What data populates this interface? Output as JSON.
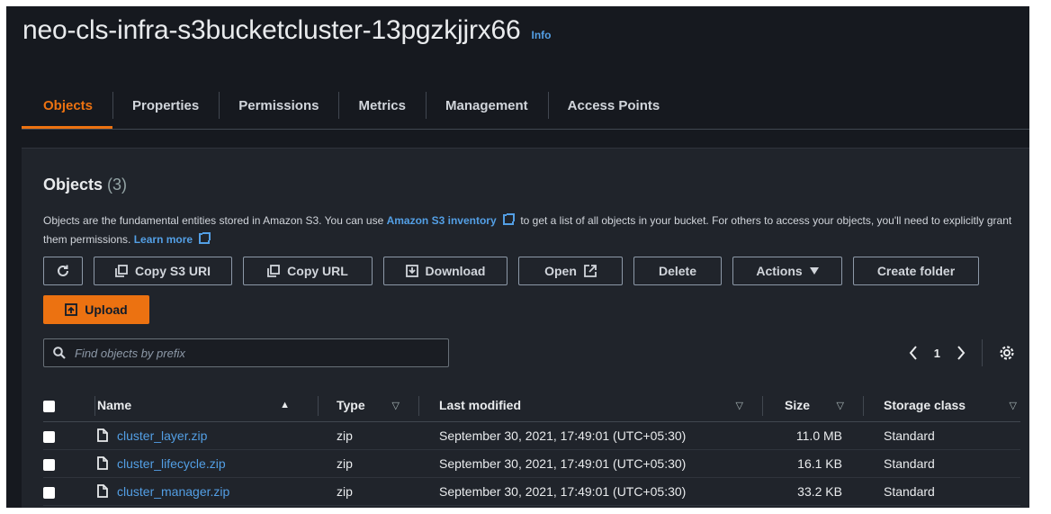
{
  "bucket": {
    "title": "neo-cls-infra-s3bucketcluster-13pgzkjjrx66",
    "info": "Info"
  },
  "tabs": [
    {
      "label": "Objects"
    },
    {
      "label": "Properties"
    },
    {
      "label": "Permissions"
    },
    {
      "label": "Metrics"
    },
    {
      "label": "Management"
    },
    {
      "label": "Access Points"
    }
  ],
  "objects": {
    "heading": "Objects",
    "count": "(3)",
    "desc_part1": "Objects are the fundamental entities stored in Amazon S3. You can use",
    "inventory_link": "Amazon S3 inventory",
    "desc_part2": "to get a list of all objects in your bucket. For others to access your objects, you'll need to explicitly grant them permissions.",
    "learn_more": "Learn more"
  },
  "toolbar": {
    "copy_uri": "Copy S3 URI",
    "copy_url": "Copy URL",
    "download": "Download",
    "open": "Open",
    "delete": "Delete",
    "actions": "Actions",
    "create_folder": "Create folder",
    "upload": "Upload"
  },
  "search": {
    "placeholder": "Find objects by prefix"
  },
  "pagination": {
    "page": "1"
  },
  "table": {
    "headers": {
      "name": "Name",
      "type": "Type",
      "last_modified": "Last modified",
      "size": "Size",
      "storage_class": "Storage class"
    },
    "rows": [
      {
        "name": "cluster_layer.zip",
        "type": "zip",
        "last_modified": "September 30, 2021, 17:49:01 (UTC+05:30)",
        "size": "11.0 MB",
        "storage_class": "Standard"
      },
      {
        "name": "cluster_lifecycle.zip",
        "type": "zip",
        "last_modified": "September 30, 2021, 17:49:01 (UTC+05:30)",
        "size": "16.1 KB",
        "storage_class": "Standard"
      },
      {
        "name": "cluster_manager.zip",
        "type": "zip",
        "last_modified": "September 30, 2021, 17:49:01 (UTC+05:30)",
        "size": "33.2 KB",
        "storage_class": "Standard"
      }
    ]
  },
  "colors": {
    "accent": "#ec7211",
    "link": "#539fe5",
    "background": "#16191f",
    "panel": "#20242b"
  }
}
